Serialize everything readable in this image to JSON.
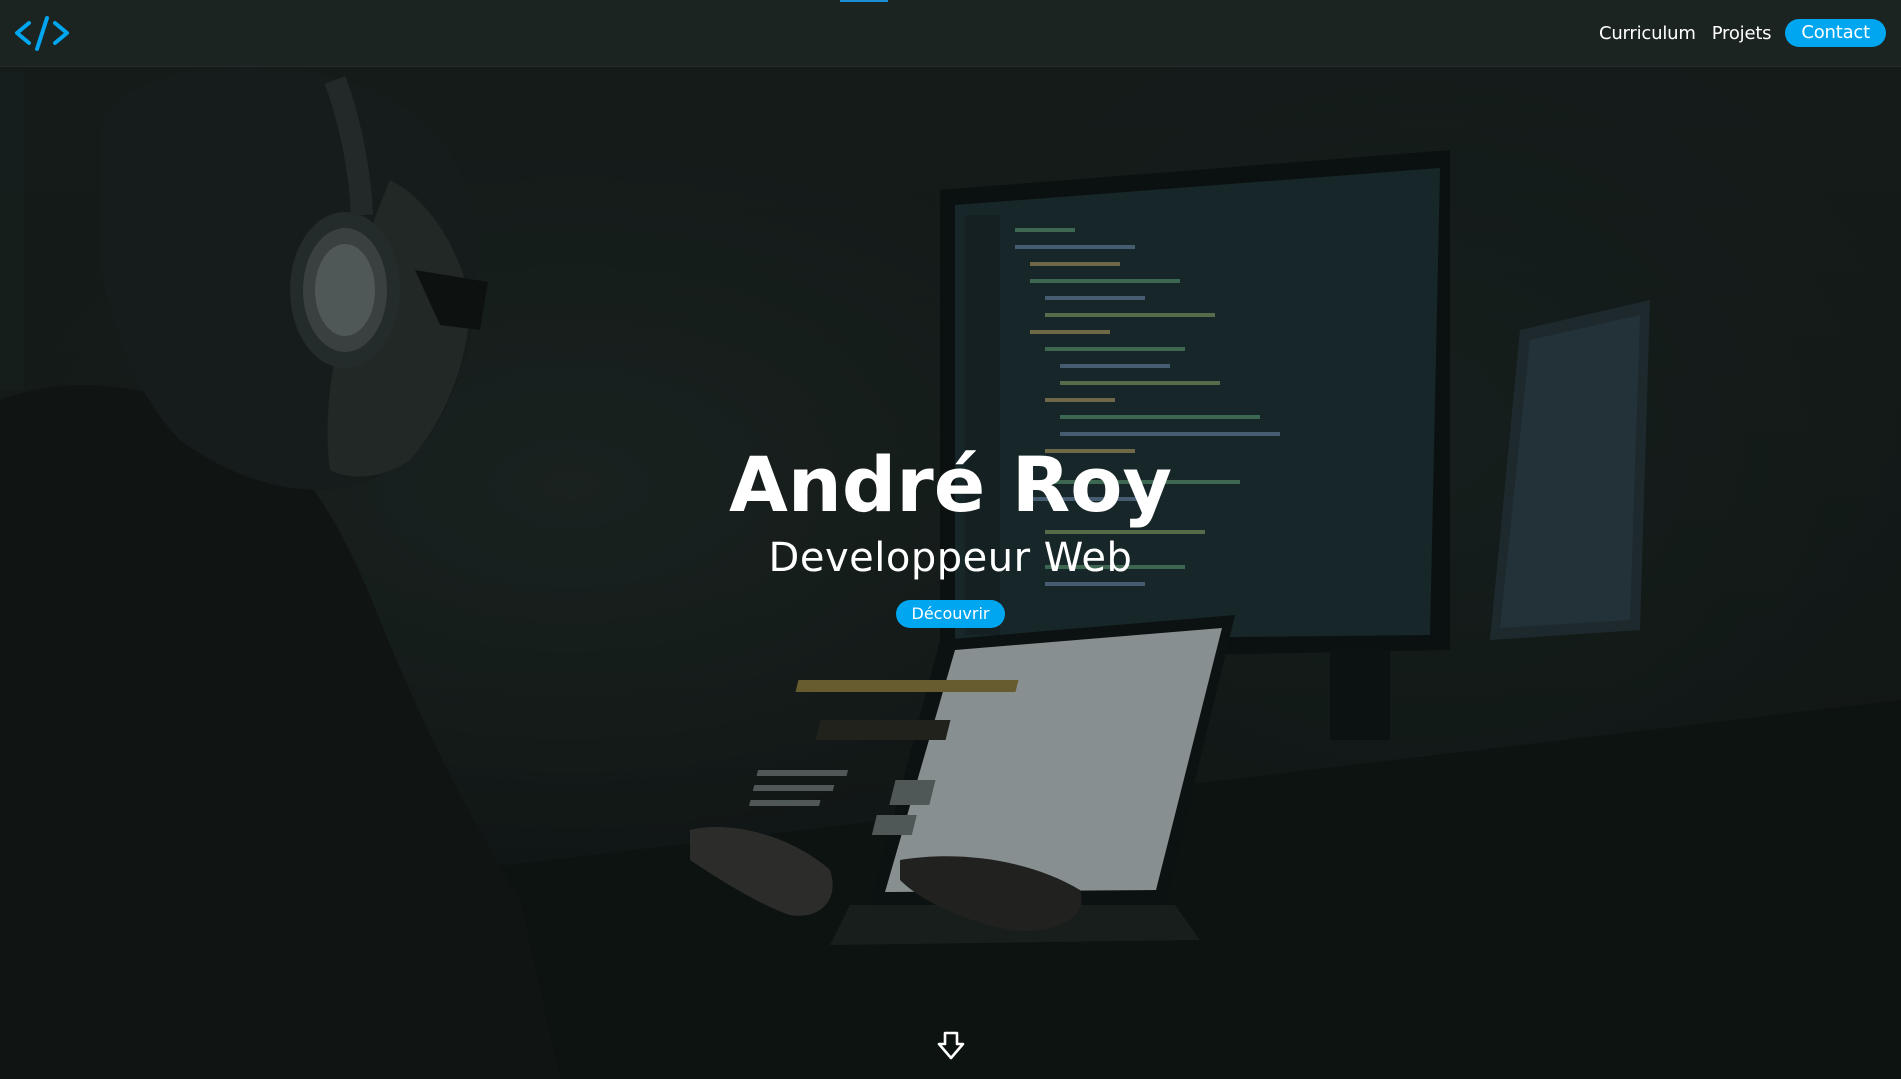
{
  "nav": {
    "logo_icon": "code-brackets-icon",
    "links": [
      {
        "label": "Curriculum"
      },
      {
        "label": "Projets"
      }
    ],
    "contact_label": "Contact"
  },
  "hero": {
    "name": "André Roy",
    "role": "Developpeur Web",
    "cta_label": "Découvrir",
    "scroll_icon": "arrow-down-icon"
  },
  "colors": {
    "accent": "#00a6ef",
    "navbar_bg": "#1c2422",
    "text": "#ffffff"
  }
}
